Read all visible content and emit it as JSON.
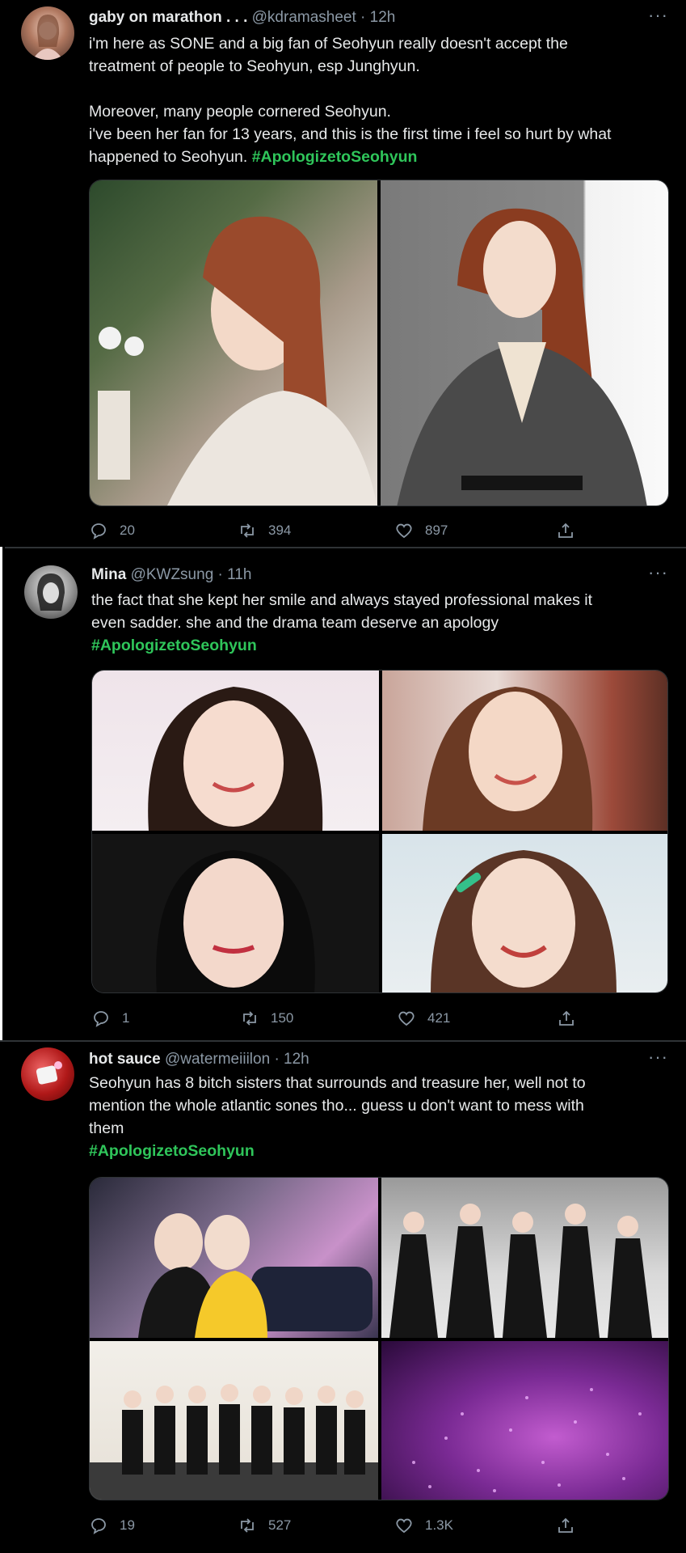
{
  "tweets": [
    {
      "name": "gaby on marathon . . .",
      "handle": "@kdramasheet",
      "time": "12h",
      "lines": [
        "i'm here as SONE and a big fan of Seohyun really doesn't accept the",
        "treatment of people to Seohyun, esp Junghyun.",
        "",
        "Moreover, many people cornered Seohyun.",
        "i've been her fan for 13 years, and this is the first time i feel so hurt by what",
        "happened to Seohyun."
      ],
      "hashtag": "#ApologizetoSeohyun",
      "replies": "20",
      "retweets": "394",
      "likes": "897"
    },
    {
      "name": "Mina",
      "handle": "@KWZsung",
      "time": "11h",
      "lines": [
        "the fact that she kept her smile and always stayed professional makes it",
        "even sadder. she and the drama team deserve an apology"
      ],
      "hashtag": "#ApologizetoSeohyun",
      "replies": "1",
      "retweets": "150",
      "likes": "421"
    },
    {
      "name": "hot sauce",
      "handle": "@watermeiiilon",
      "time": "12h",
      "lines": [
        "Seohyun has 8 bitch sisters that surrounds and treasure her, well not to",
        "mention the whole atlantic sones tho... guess u don't want to mess with",
        "them"
      ],
      "hashtag": "#ApologizetoSeohyun",
      "replies": "19",
      "retweets": "527",
      "likes": "1.3K"
    }
  ],
  "colors": {
    "background": "#000000",
    "hashtag": "#2fc55a",
    "secondary_text": "#8b98a5",
    "primary_text": "#e7e9ea"
  },
  "icons": [
    "reply-icon",
    "retweet-icon",
    "like-icon",
    "share-icon",
    "more-icon"
  ]
}
